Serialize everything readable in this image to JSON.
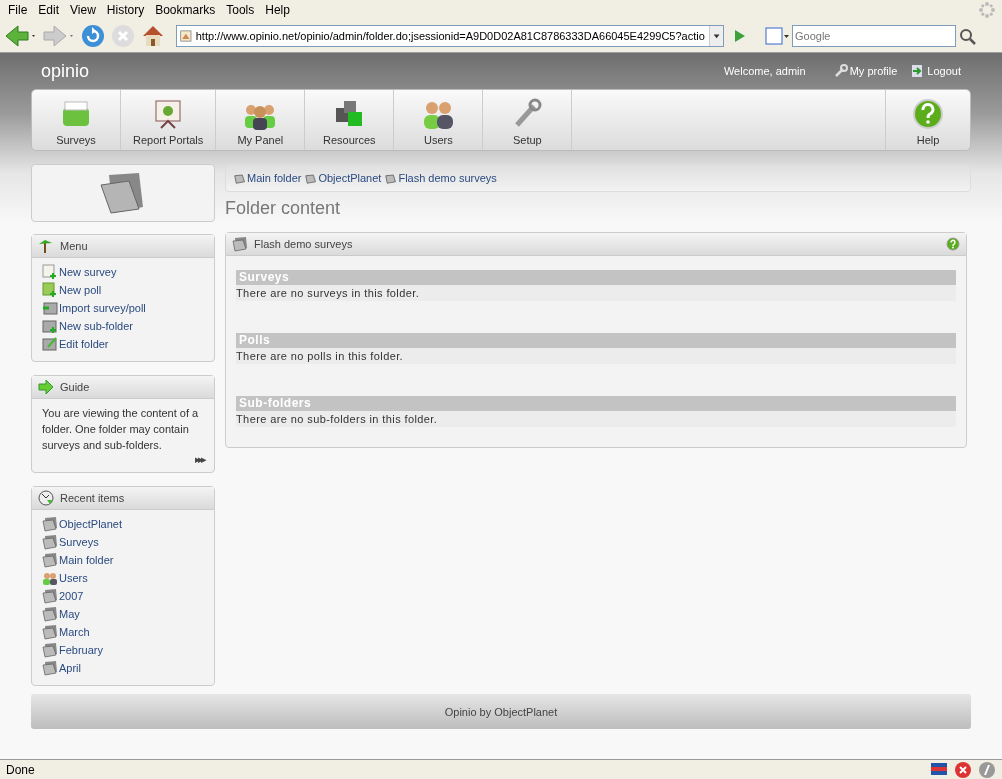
{
  "browser": {
    "menu": [
      "File",
      "Edit",
      "View",
      "History",
      "Bookmarks",
      "Tools",
      "Help"
    ],
    "url": "http://www.opinio.net/opinio/admin/folder.do;jsessionid=A9D0D02A81C8786333DA66045E4299C5?actio",
    "search_placeholder": "Google",
    "status": "Done"
  },
  "header": {
    "logo": "opinio",
    "welcome": "Welcome, admin",
    "links": [
      {
        "kind": "profile",
        "label": "My profile"
      },
      {
        "kind": "logout",
        "label": "Logout"
      }
    ]
  },
  "nav": [
    {
      "kind": "surveys",
      "label": "Surveys"
    },
    {
      "kind": "portals",
      "label": "Report Portals"
    },
    {
      "kind": "panel",
      "label": "My Panel"
    },
    {
      "kind": "resources",
      "label": "Resources"
    },
    {
      "kind": "users",
      "label": "Users"
    },
    {
      "kind": "setup",
      "label": "Setup"
    }
  ],
  "help": "Help",
  "breadcrumb": [
    "Main folder",
    "ObjectPlanet",
    "Flash demo surveys"
  ],
  "page_title": "Folder content",
  "menu": {
    "title": "Menu",
    "items": [
      {
        "kind": "doc",
        "label": "New survey"
      },
      {
        "kind": "poll",
        "label": "New poll"
      },
      {
        "kind": "import",
        "label": "Import survey/poll"
      },
      {
        "kind": "folder",
        "label": "New sub-folder"
      },
      {
        "kind": "edit",
        "label": "Edit folder"
      }
    ]
  },
  "guide": {
    "title": "Guide",
    "text": "You are viewing the content of a folder. One folder may contain surveys and sub-folders.",
    "more": "▸▸▸"
  },
  "recent": {
    "title": "Recent items",
    "items": [
      {
        "kind": "folder",
        "label": "ObjectPlanet"
      },
      {
        "kind": "folder",
        "label": "Surveys"
      },
      {
        "kind": "folder",
        "label": "Main folder"
      },
      {
        "kind": "users",
        "label": "Users"
      },
      {
        "kind": "folder",
        "label": "2007"
      },
      {
        "kind": "folder",
        "label": "May"
      },
      {
        "kind": "folder",
        "label": "March"
      },
      {
        "kind": "folder",
        "label": "February"
      },
      {
        "kind": "folder",
        "label": "April"
      }
    ]
  },
  "content": {
    "title": "Flash demo surveys",
    "sections": [
      {
        "heading": "Surveys",
        "text": "There are no surveys in this folder."
      },
      {
        "heading": "Polls",
        "text": "There are no polls in this folder."
      },
      {
        "heading": "Sub-folders",
        "text": "There are no sub-folders in this folder."
      }
    ]
  },
  "footer": "Opinio by ObjectPlanet"
}
